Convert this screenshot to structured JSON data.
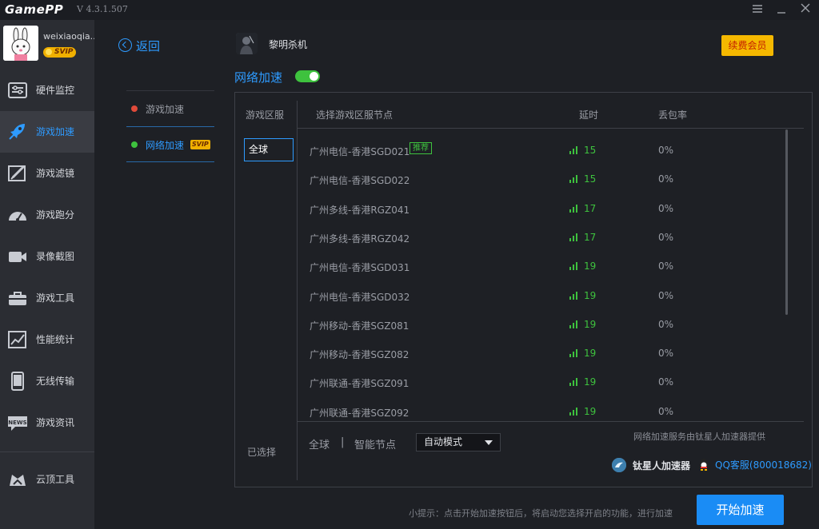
{
  "app": {
    "logo": "GamePP",
    "version": "V 4.3.1.507",
    "window_controls": [
      "menu-icon",
      "minimize-icon",
      "close-icon"
    ]
  },
  "user": {
    "name": "weixiaoqia..",
    "badge": "SVIP"
  },
  "sidebar": {
    "items": [
      {
        "label": "硬件监控",
        "icon": "hardware-monitor-icon",
        "active": false
      },
      {
        "label": "游戏加速",
        "icon": "rocket-icon",
        "active": true
      },
      {
        "label": "游戏滤镜",
        "icon": "filter-icon",
        "active": false
      },
      {
        "label": "游戏跑分",
        "icon": "speedometer-icon",
        "active": false
      },
      {
        "label": "录像截图",
        "icon": "video-camera-icon",
        "active": false
      },
      {
        "label": "游戏工具",
        "icon": "toolbox-icon",
        "active": false
      },
      {
        "label": "性能统计",
        "icon": "chart-icon",
        "active": false
      },
      {
        "label": "无线传输",
        "icon": "phone-icon",
        "active": false
      },
      {
        "label": "游戏资讯",
        "icon": "news-icon",
        "active": false
      },
      {
        "label": "云顶工具",
        "icon": "crown-icon",
        "active": false
      }
    ]
  },
  "subnav": {
    "back_label": "返回",
    "items": [
      {
        "label": "游戏加速",
        "dot_color": "#e04a3a",
        "active": false
      },
      {
        "label": "网络加速",
        "dot_color": "#3ec23e",
        "active": true,
        "badge": "SVIP"
      }
    ]
  },
  "header": {
    "game_name": "黎明杀机",
    "renew_label": "续费会员",
    "section_title": "网络加速",
    "toggle_on": true
  },
  "table": {
    "columns": {
      "region": "游戏区服",
      "node": "选择游戏区服节点",
      "latency": "延时",
      "loss": "丢包率"
    },
    "selected_region": "全球",
    "rows": [
      {
        "node": "广州电信-香港SGD021",
        "tag": "推荐",
        "latency": "15",
        "loss": "0%"
      },
      {
        "node": "广州电信-香港SGD022",
        "tag": "",
        "latency": "15",
        "loss": "0%"
      },
      {
        "node": "广州多线-香港RGZ041",
        "tag": "",
        "latency": "17",
        "loss": "0%"
      },
      {
        "node": "广州多线-香港RGZ042",
        "tag": "",
        "latency": "17",
        "loss": "0%"
      },
      {
        "node": "广州电信-香港SGD031",
        "tag": "",
        "latency": "19",
        "loss": "0%"
      },
      {
        "node": "广州电信-香港SGD032",
        "tag": "",
        "latency": "19",
        "loss": "0%"
      },
      {
        "node": "广州移动-香港SGZ081",
        "tag": "",
        "latency": "19",
        "loss": "0%"
      },
      {
        "node": "广州移动-香港SGZ082",
        "tag": "",
        "latency": "19",
        "loss": "0%"
      },
      {
        "node": "广州联通-香港SGZ091",
        "tag": "",
        "latency": "19",
        "loss": "0%"
      },
      {
        "node": "广州联通-香港SGZ092",
        "tag": "",
        "latency": "19",
        "loss": "0%"
      }
    ]
  },
  "footer": {
    "selected_label": "已选择",
    "region": "全球",
    "separator": "|",
    "node": "智能节点",
    "mode": "自动模式",
    "provider_note": "网络加速服务由钛星人加速器提供",
    "brand": "钛星人加速器",
    "support": "QQ客服(800018682)"
  },
  "bottom": {
    "hint": "小提示：点击开始加速按钮后，将启动您选择开启的功能，进行加速",
    "start_label": "开始加速"
  },
  "colors": {
    "accent": "#2e9bff",
    "green": "#3ec23e",
    "gold": "#f5b800",
    "background": "#1e2025",
    "sidebar": "#2b2d33"
  }
}
